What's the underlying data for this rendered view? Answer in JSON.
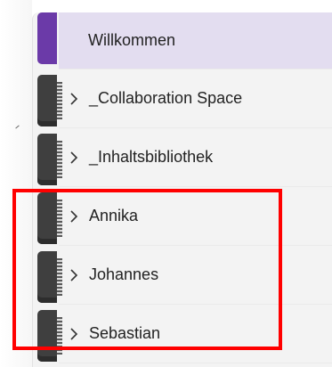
{
  "notebook": {
    "sections": [
      {
        "label": "Willkommen",
        "expandable": false,
        "active": true
      },
      {
        "label": "_Collaboration Space",
        "expandable": true,
        "active": false
      },
      {
        "label": "_Inhaltsbibliothek",
        "expandable": true,
        "active": false
      },
      {
        "label": "Annika",
        "expandable": true,
        "active": false
      },
      {
        "label": "Johannes",
        "expandable": true,
        "active": false
      },
      {
        "label": "Sebastian",
        "expandable": true,
        "active": false
      }
    ]
  },
  "colors": {
    "active_tab": "#6b3aa8",
    "active_row": "#e3ddf0",
    "annotation_box": "#ff0000"
  },
  "icons": {
    "expand": "chevron-right-icon"
  }
}
